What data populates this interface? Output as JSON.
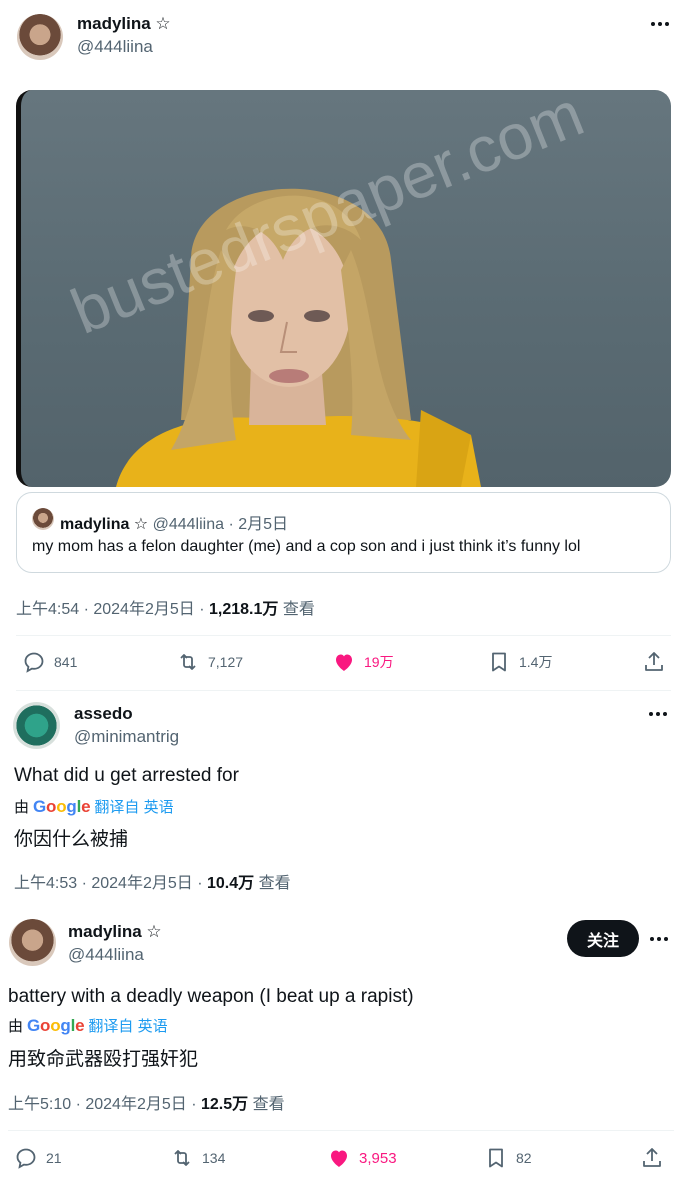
{
  "main_tweet": {
    "author_name": "madylina ☆",
    "author_handle": "@444liina",
    "photo_watermark": "bustedrspaper.com",
    "quote": {
      "author_name": "madylina ☆",
      "author_handle": "@444liina",
      "date": "· 2月5日",
      "text": "my mom has a felon daughter (me) and a cop son and i just think it’s funny lol"
    },
    "meta_time": "上午4:54 · 2024年2月5日 · ",
    "meta_views": "1,218.1万",
    "meta_views_suffix": " 查看",
    "actions": {
      "replies": "841",
      "retweets": "7,127",
      "likes": "19万",
      "bookmarks": "1.4万"
    }
  },
  "reply_1": {
    "author_name": "assedo",
    "author_handle": "@minimantrig",
    "text": "What did u get arrested for",
    "translated_by": "由",
    "translate_label": "翻译自 英语",
    "translation": "你因什么被捕",
    "meta_time": "上午4:53 · 2024年2月5日 · ",
    "meta_views": "10.4万",
    "meta_views_suffix": " 查看"
  },
  "reply_2": {
    "author_name": "madylina ☆",
    "author_handle": "@444liina",
    "follow_label": "关注",
    "text": "battery with a deadly weapon (I beat up a rapist)",
    "translated_by": "由",
    "translate_label": "翻译自 英语",
    "translation": "用致命武器殴打强奸犯",
    "meta_time": "上午5:10 · 2024年2月5日 · ",
    "meta_views": "12.5万",
    "meta_views_suffix": " 查看",
    "actions": {
      "replies": "21",
      "retweets": "134",
      "likes": "3,953",
      "bookmarks": "82"
    }
  },
  "google_word": [
    "G",
    "o",
    "o",
    "g",
    "l",
    "e"
  ],
  "colors": {
    "like": "#f91880",
    "link": "#1d9bf0",
    "muted": "#536471",
    "photo_bg": "#5a6b73",
    "jumpsuit": "#e8b21a"
  },
  "icons": [
    "more-icon",
    "reply-icon",
    "retweet-icon",
    "like-icon",
    "bookmark-icon",
    "share-icon",
    "avatar"
  ]
}
